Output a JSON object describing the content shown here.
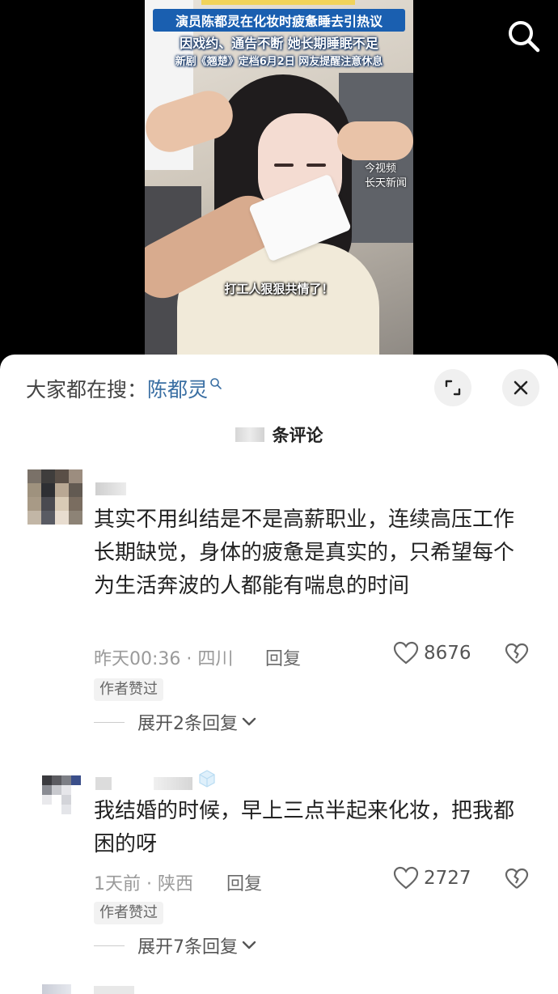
{
  "video": {
    "headline_line1": "演员陈都灵在化妆时疲惫睡去引热议",
    "headline_line2": "因戏约、通告不断 她长期睡眠不足",
    "headline_line3": "新剧《翘楚》定档6月2日 网友提醒注意休息",
    "watermark_line1": "今视频",
    "watermark_line2": "长天新闻",
    "subtitle": "打工人狠狠共情了！"
  },
  "search_bar": {
    "prefix": "大家都在搜：",
    "keyword": "陈都灵"
  },
  "comments_header": {
    "count_label": "条评论"
  },
  "comments": [
    {
      "text": "其实不用纠结是不是高薪职业，连续高压工作长期缺觉，身体的疲惫是真实的，只希望每个为生活奔波的人都能有喘息的时间",
      "meta": "昨天00:36 · 四川",
      "reply_label": "回复",
      "likes": "8676",
      "badge": "作者赞过",
      "expand_label": "展开2条回复"
    },
    {
      "text": "我结婚的时候，早上三点半起来化妆，把我都困的呀",
      "meta": "1天前 · 陕西",
      "reply_label": "回复",
      "likes": "2727",
      "badge": "作者赞过",
      "expand_label": "展开7条回复"
    }
  ],
  "colors": {
    "keyword": "#3a6fa3",
    "banner": "#1a5fb0"
  }
}
